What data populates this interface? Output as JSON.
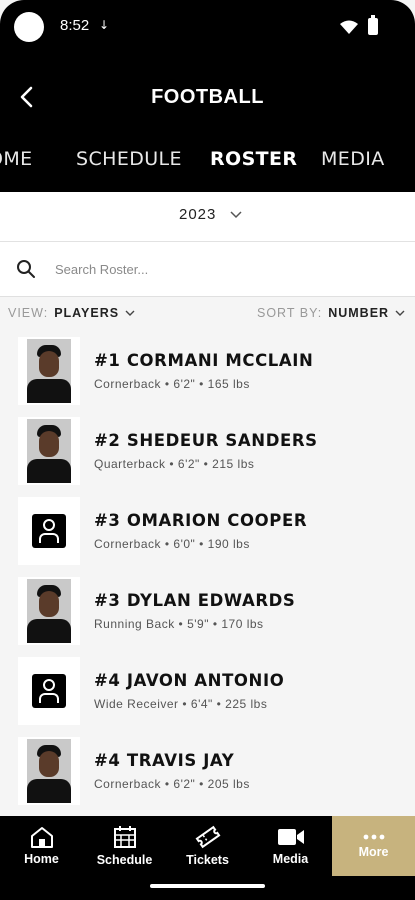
{
  "status_bar": {
    "time": "8:52"
  },
  "header": {
    "title": "FOOTBALL"
  },
  "tabs": [
    {
      "label": "HOME",
      "visible_text": "OME",
      "active": false
    },
    {
      "label": "SCHEDULE",
      "active": false
    },
    {
      "label": "ROSTER",
      "active": true
    },
    {
      "label": "MEDIA",
      "active": false
    }
  ],
  "season": {
    "value": "2023"
  },
  "search": {
    "placeholder": "Search Roster..."
  },
  "filters": {
    "view_key": "VIEW:",
    "view_value": "PLAYERS",
    "sort_key": "SORT BY:",
    "sort_value": "NUMBER"
  },
  "roster": [
    {
      "name": "#1 CORMANI MCCLAIN",
      "info": "Cornerback • 6'2\" • 165 lbs",
      "photo": "headshot"
    },
    {
      "name": "#2 SHEDEUR SANDERS",
      "info": "Quarterback • 6'2\" • 215 lbs",
      "photo": "headshot"
    },
    {
      "name": "#3 OMARION COOPER",
      "info": "Cornerback • 6'0\" • 190 lbs",
      "photo": "placeholder"
    },
    {
      "name": "#3 DYLAN EDWARDS",
      "info": "Running Back • 5'9\" • 170 lbs",
      "photo": "headshot"
    },
    {
      "name": "#4 JAVON ANTONIO",
      "info": "Wide Receiver • 6'4\" • 225 lbs",
      "photo": "placeholder"
    },
    {
      "name": "#4 TRAVIS JAY",
      "info": "Cornerback • 6'2\" • 205 lbs",
      "photo": "headshot"
    }
  ],
  "bottom_nav": [
    {
      "label": "Home",
      "icon": "home-icon"
    },
    {
      "label": "Schedule",
      "icon": "calendar-icon"
    },
    {
      "label": "Tickets",
      "icon": "ticket-icon"
    },
    {
      "label": "Media",
      "icon": "video-camera-icon"
    },
    {
      "label": "More",
      "icon": "more-dots-icon",
      "active": true
    }
  ],
  "colors": {
    "accent": "#c7b37e",
    "header_bg": "#000000"
  }
}
